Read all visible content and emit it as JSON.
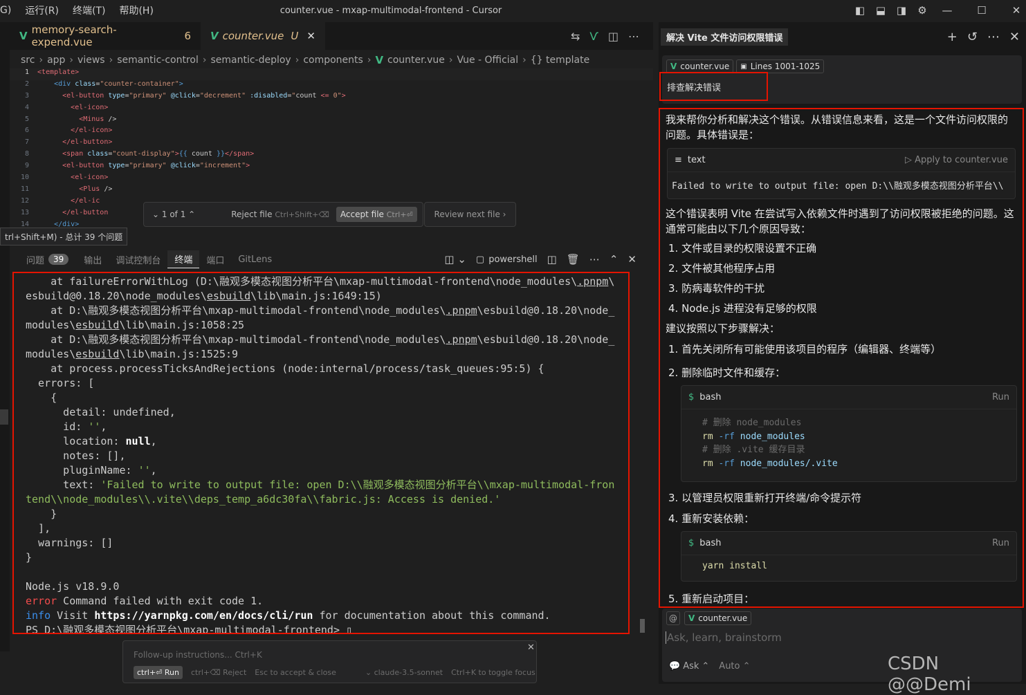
{
  "window": {
    "title": "counter.vue - mxap-multimodal-frontend - Cursor",
    "menu": [
      "G)",
      "运行(R)",
      "终端(T)",
      "帮助(H)"
    ]
  },
  "tabs": [
    {
      "label": "memory-search-expend.vue",
      "badge": "6"
    },
    {
      "label": "counter.vue",
      "badge": "U"
    }
  ],
  "breadcrumb": [
    "src",
    "app",
    "views",
    "semantic-control",
    "semantic-deploy",
    "components",
    "counter.vue",
    "Vue - Official",
    "{} template"
  ],
  "code_lines": [
    {
      "n": "1",
      "html": "<span class='tg'>&lt;template&gt;</span>"
    },
    {
      "n": "2",
      "html": "    <span class='tgb'>&lt;div</span> <span class='at'>class</span>=<span class='st'>\"counter-container\"</span><span class='tgb'>&gt;</span>"
    },
    {
      "n": "3",
      "html": "      <span class='tg'>&lt;el-button</span> <span class='at'>type</span>=<span class='st'>\"primary\"</span> <span class='at'>@click</span>=<span class='st'>\"decrement\"</span> <span class='at'>:disabled</span>=<span class='st'>\"</span><span class='tx'>count</span> <span class='tg'>&lt;=</span> <span class='st'>0\"</span><span class='tg'>&gt;</span>"
    },
    {
      "n": "4",
      "html": "        <span class='tg'>&lt;el-icon&gt;</span>"
    },
    {
      "n": "5",
      "html": "          <span class='tg'>&lt;Minus</span> <span class='tx'>/&gt;</span>"
    },
    {
      "n": "6",
      "html": "        <span class='tg'>&lt;/el-icon&gt;</span>"
    },
    {
      "n": "7",
      "html": "      <span class='tg'>&lt;/el-button&gt;</span>"
    },
    {
      "n": "8",
      "html": "      <span class='tg'>&lt;span</span> <span class='at'>class</span>=<span class='st'>\"count-display\"</span><span class='tg'>&gt;</span><span class='tgb'>{{</span> <span class='tx'>count</span> <span class='tgb'>}}</span><span class='tg'>&lt;/span&gt;</span>"
    },
    {
      "n": "9",
      "html": "      <span class='tg'>&lt;el-button</span> <span class='at'>type</span>=<span class='st'>\"primary\"</span> <span class='at'>@click</span>=<span class='st'>\"increment\"</span><span class='tg'>&gt;</span>"
    },
    {
      "n": "10",
      "html": "        <span class='tg'>&lt;el-icon&gt;</span>"
    },
    {
      "n": "11",
      "html": "          <span class='tg'>&lt;Plus</span> <span class='tx'>/&gt;</span>"
    },
    {
      "n": "12",
      "html": "        <span class='tg'>&lt;/el-ic</span>"
    },
    {
      "n": "13",
      "html": "      <span class='tg'>&lt;/el-button</span>"
    },
    {
      "n": "14",
      "html": "    <span class='tgb'>&lt;/div&gt;</span>"
    }
  ],
  "accept_bar": {
    "counter": "1 of 1",
    "reject": "Reject file",
    "reject_shortcut": "Ctrl+Shift+⌫",
    "accept": "Accept file",
    "accept_shortcut": "Ctrl+⏎",
    "review": "Review next file"
  },
  "tooltip": "trl+Shift+M) - 总计 39 个问题",
  "panel": {
    "tabs": [
      "问题",
      "输出",
      "调试控制台",
      "终端",
      "端口",
      "GitLens"
    ],
    "problems_count": "39",
    "shell": "powershell"
  },
  "terminal_lines": [
    "    at failureErrorWithLog (D:\\融观多模态视图分析平台\\mxap-multimodal-frontend\\node_modules\\<u>.pnpm</u>\\",
    "esbuild@0.18.20\\node_modules\\<u>esbuild</u>\\lib\\main.js:1649:15)",
    "    at D:\\融观多模态视图分析平台\\mxap-multimodal-frontend\\node_modules\\<u>.pnpm</u>\\esbuild@0.18.20\\node_",
    "modules\\<u>esbuild</u>\\lib\\main.js:1058:25",
    "    at D:\\融观多模态视图分析平台\\mxap-multimodal-frontend\\node_modules\\<u>.pnpm</u>\\esbuild@0.18.20\\node_",
    "modules\\<u>esbuild</u>\\lib\\main.js:1525:9",
    "    at process.processTicksAndRejections (node:internal/process/task_queues:95:5) {",
    "  errors: [",
    "    {",
    "      detail: undefined,",
    "      id: <s>''</s>,",
    "      location: <b>null</b>,",
    "      notes: [],",
    "      pluginName: <s>''</s>,",
    "      text: <s>'Failed to write to output file: open D:\\\\融观多模态视图分析平台\\\\mxap-multimodal-fron</s>",
    "<s>tend\\\\node_modules\\\\.vite\\\\deps_temp_a6dc30fa\\\\fabric.js: Access is denied.'</s>",
    "    }",
    "  ],",
    "  warnings: []",
    "}",
    "",
    "Node.js v18.9.0",
    "<e>error</e> Command failed with exit code 1.",
    "<i>info</i> Visit <b>https://yarnpkg.com/en/docs/cli/run</b> for documentation about this command.",
    "PS D:\\融观多模态视图分析平台\\mxap-multimodal-frontend> ▯"
  ],
  "followup": {
    "placeholder": "Follow-up instructions... Ctrl+K",
    "run": "ctrl+⏎ Run",
    "reject": "ctrl+⌫ Reject",
    "accept": "Esc to accept & close",
    "model": "claude-3.5-sonnet",
    "toggle": "Ctrl+K to toggle focus"
  },
  "chat": {
    "title": "解决 Vite 文件访问权限错误",
    "context_file": "counter.vue",
    "context_lines": "Lines 1001-1025",
    "user_message": "排查解决错误",
    "intro": "我来帮你分析和解决这个错误。从错误信息来看，这是一个文件访问权限的问题。具体错误是：",
    "block1_lang": "text",
    "block1_apply": "Apply to counter.vue",
    "block1_code": "Failed to write to output file: open D:\\\\融观多模态视图分析平台\\\\",
    "para2": "这个错误表明 Vite 在尝试写入依赖文件时遇到了访问权限被拒绝的问题。这通常可能由以下几个原因导致：",
    "causes": [
      "1. 文件或目录的权限设置不正确",
      "2. 文件被其他程序占用",
      "3. 防病毒软件的干扰",
      "4. Node.js 进程没有足够的权限"
    ],
    "para3": "建议按照以下步骤解决：",
    "step1": "1. 首先关闭所有可能使用该项目的程序（编辑器、终端等）",
    "step2": "2. 删除临时文件和缓存：",
    "bash_label": "bash",
    "run_label": "Run",
    "bash1": {
      "c1": "# 删除 node_modules",
      "l1": [
        "rm",
        "-rf",
        "node_modules"
      ],
      "c2": "# 删除 .vite 缓存目录",
      "l2": [
        "rm",
        "-rf",
        "node_modules/.vite"
      ]
    },
    "step3": "3. 以管理员权限重新打开终端/命令提示符",
    "step4": "4. 重新安装依赖：",
    "bash2": "yarn install",
    "step5": "5. 重新启动项目：",
    "input_file": "counter.vue",
    "input_placeholder": "Ask, learn, brainstorm",
    "mode": "Ask",
    "auto": "Auto"
  },
  "watermark": "CSDN @@Demi"
}
